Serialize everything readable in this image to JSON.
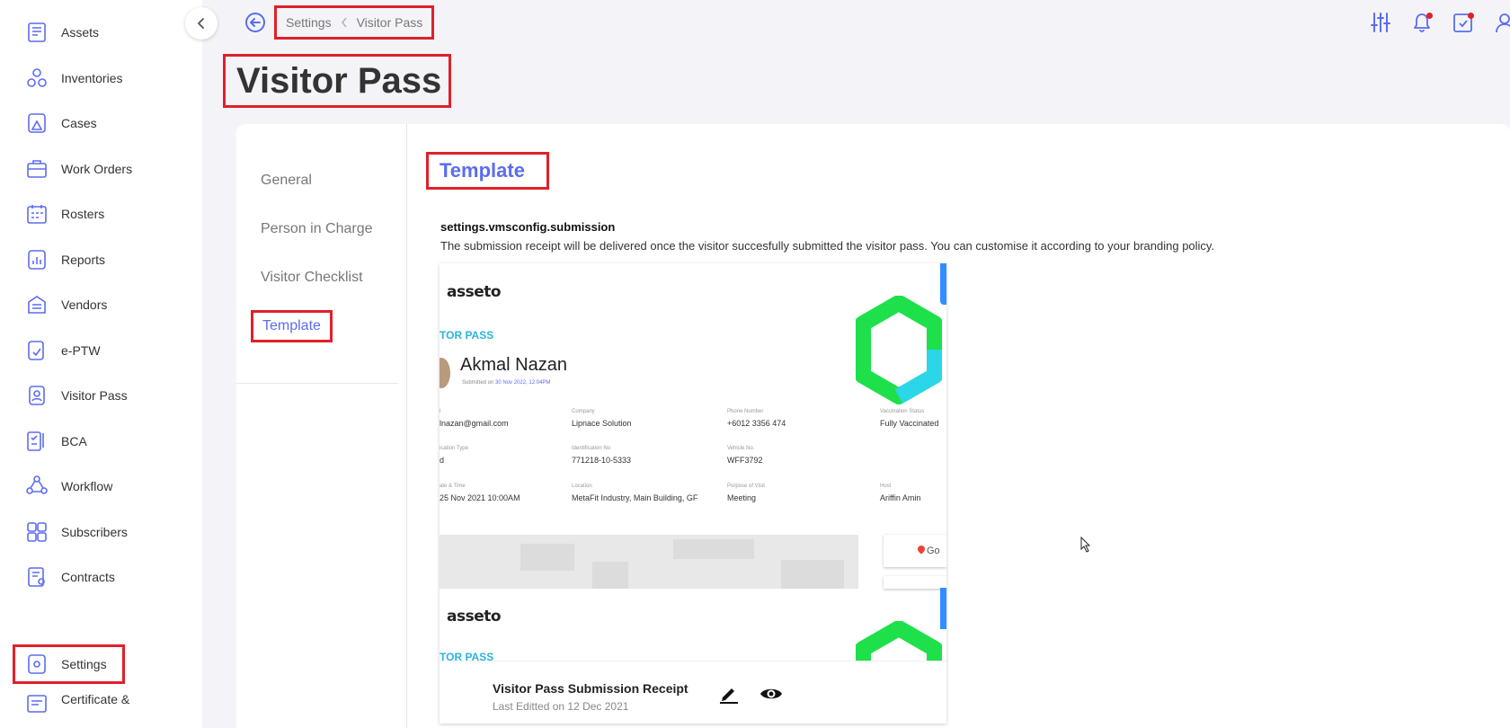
{
  "sidebar": {
    "items": [
      {
        "label": "Assets",
        "icon": "assets-icon"
      },
      {
        "label": "Inventories",
        "icon": "inventories-icon"
      },
      {
        "label": "Cases",
        "icon": "cases-icon"
      },
      {
        "label": "Work Orders",
        "icon": "work-orders-icon"
      },
      {
        "label": "Rosters",
        "icon": "rosters-icon"
      },
      {
        "label": "Reports",
        "icon": "reports-icon"
      },
      {
        "label": "Vendors",
        "icon": "vendors-icon"
      },
      {
        "label": "e-PTW",
        "icon": "eptw-icon"
      },
      {
        "label": "Visitor Pass",
        "icon": "visitor-pass-icon"
      },
      {
        "label": "BCA",
        "icon": "bca-icon"
      },
      {
        "label": "Workflow",
        "icon": "workflow-icon"
      },
      {
        "label": "Subscribers",
        "icon": "subscribers-icon"
      },
      {
        "label": "Contracts",
        "icon": "contracts-icon"
      },
      {
        "label": "Settings",
        "icon": "settings-icon",
        "active": true
      },
      {
        "label": "Certificate &",
        "icon": "certificate-icon"
      }
    ]
  },
  "header": {
    "breadcrumb": [
      "Settings",
      "Visitor Pass"
    ],
    "icons": [
      "filter-sliders-icon",
      "notification-bell-icon",
      "task-calendar-icon",
      "user-profile-icon"
    ]
  },
  "page": {
    "title": "Visitor Pass"
  },
  "settings_menu": {
    "items": [
      "General",
      "Person in Charge",
      "Visitor Checklist",
      "Template"
    ],
    "active": "Template"
  },
  "content": {
    "section_title": "Template",
    "key": "settings.vmsconfig.submission",
    "description": "The submission receipt will be delivered once the visitor succesfully submitted the visitor pass. You can customise it according to your branding policy."
  },
  "template_card": {
    "preview": {
      "logo": "asseto",
      "pass_label": "TOR PASS",
      "visitor_name": "Akmal Nazan",
      "submitted_prefix": "Submitted on ",
      "submitted_date": "30 Nov 2022, 12:04PM",
      "fields": [
        {
          "key": "l",
          "value": "lnazan@gmail.com"
        },
        {
          "key": "Company",
          "value": "Lipnace Solution"
        },
        {
          "key": "Phone Number",
          "value": "+6012 3356 474"
        },
        {
          "key": "Vaccination Status",
          "value": "Fully Vaccinated"
        },
        {
          "key": "ication Type",
          "value": "d"
        },
        {
          "key": "Identification No",
          "value": "771218-10-5333"
        },
        {
          "key": "Vehicle No.",
          "value": "WFF3792"
        },
        {
          "key": "ate & Time",
          "value": "25 Nov 2021 10:00AM"
        },
        {
          "key": "Location",
          "value": "MetaFit Industry, Main Building, GF"
        },
        {
          "key": "Purpose of Visit",
          "value": "Meeting"
        },
        {
          "key": "Host",
          "value": "Ariffin Amin"
        }
      ],
      "map_label": "Go"
    },
    "title": "Visitor Pass Submission Receipt",
    "subtitle": "Last Editted on 12 Dec 2021"
  }
}
